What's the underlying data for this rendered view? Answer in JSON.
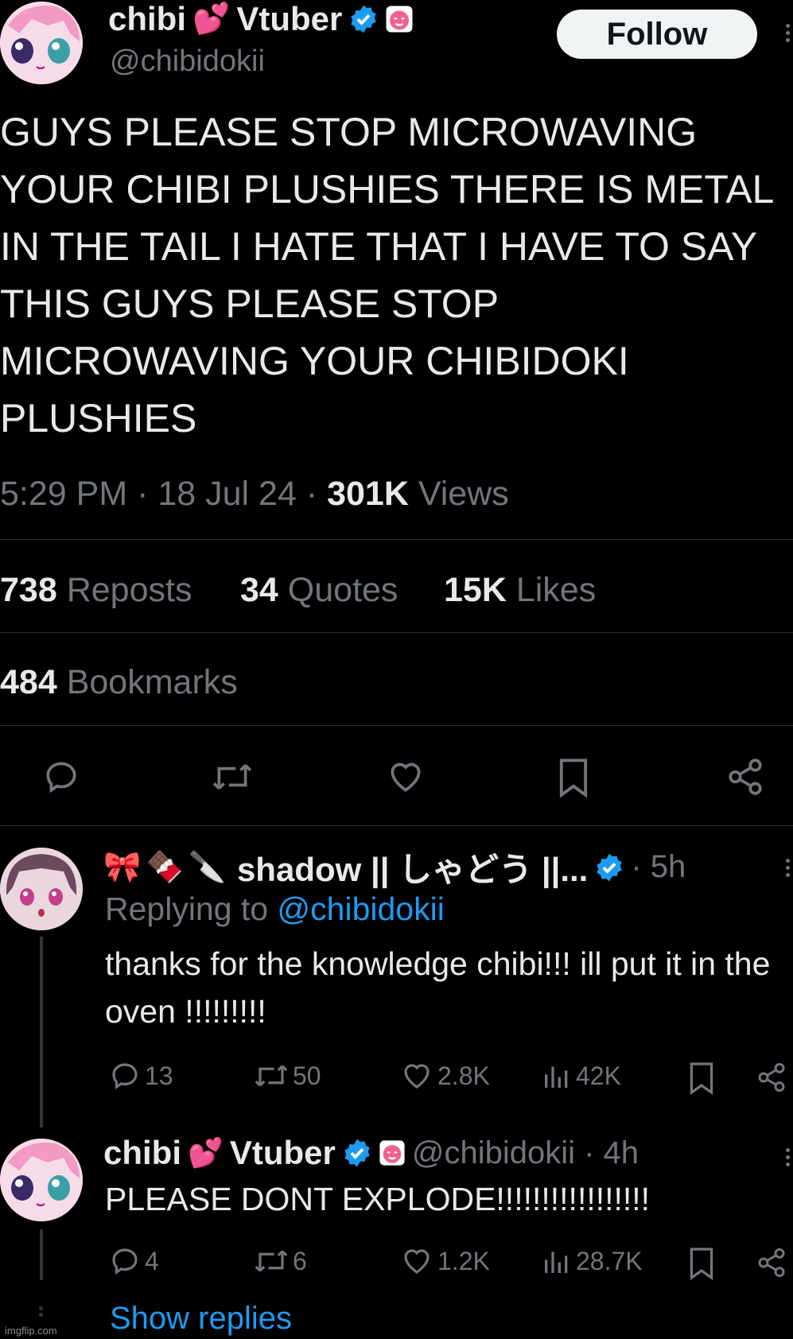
{
  "main_tweet": {
    "author_name": "chibi",
    "author_name_suffix": "Vtuber",
    "name_emoji": "💕",
    "handle": "@chibidokii",
    "follow_label": "Follow",
    "text": "GUYS PLEASE STOP MICROWAVING YOUR CHIBI PLUSHIES THERE IS METAL IN THE TAIL I HATE THAT I HAVE TO SAY THIS GUYS PLEASE STOP MICROWAVING YOUR CHIBIDOKI PLUSHIES",
    "time": "5:29 PM · 18 Jul 24 · ",
    "views_count": "301K",
    "views_label": "Views",
    "reposts_count": "738",
    "reposts_label": "Reposts",
    "quotes_count": "34",
    "quotes_label": "Quotes",
    "likes_count": "15K",
    "likes_label": "Likes",
    "bookmarks_count": "484",
    "bookmarks_label": "Bookmarks"
  },
  "reply1": {
    "emojis": "🎀🍫🔪",
    "author_name": "shadow || しゃどう ||...",
    "time": "· 5h",
    "replying_prefix": "Replying to",
    "replying_handle": "@chibidokii",
    "text": "thanks for the knowledge chibi!!! ill put it in the oven !!!!!!!!!",
    "replies": "13",
    "reposts": "50",
    "likes": "2.8K",
    "views": "42K"
  },
  "reply2": {
    "author_name": "chibi",
    "name_emoji": "💕",
    "author_name_suffix": "Vtuber",
    "handle_time": "@chibidokii · 4h",
    "text": "PLEASE DONT EXPLODE!!!!!!!!!!!!!!!!!",
    "replies": "4",
    "reposts": "6",
    "likes": "1.2K",
    "views": "28.7K"
  },
  "show_replies": "Show replies",
  "watermark": "imgflip.com",
  "colors": {
    "accent": "#1d9bf0",
    "muted": "#71767b",
    "text": "#e7e9ea",
    "bg": "#000000"
  }
}
